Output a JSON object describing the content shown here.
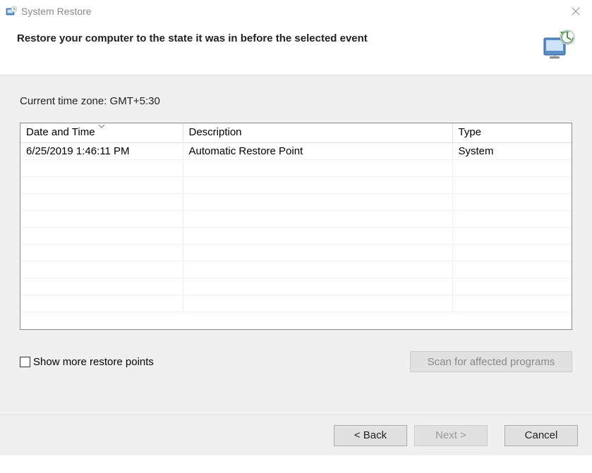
{
  "window": {
    "title": "System Restore"
  },
  "header": {
    "title": "Restore your computer to the state it was in before the selected event"
  },
  "content": {
    "timezone_label": "Current time zone: GMT+5:30",
    "table": {
      "columns": {
        "date": "Date and Time",
        "description": "Description",
        "type": "Type"
      },
      "rows": [
        {
          "date": "6/25/2019 1:46:11 PM",
          "description": "Automatic Restore Point",
          "type": "System"
        }
      ]
    },
    "checkbox_label": "Show more restore points",
    "scan_button": "Scan for affected programs"
  },
  "footer": {
    "back": "< Back",
    "next": "Next >",
    "cancel": "Cancel"
  }
}
